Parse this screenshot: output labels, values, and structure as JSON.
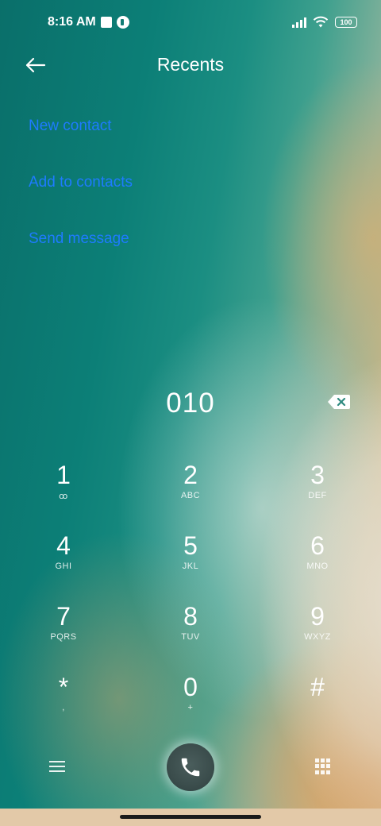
{
  "status_bar": {
    "time": "8:16 AM",
    "battery": "100"
  },
  "header": {
    "title": "Recents",
    "back_icon": "arrow-left-icon"
  },
  "actions": [
    {
      "label": "New contact"
    },
    {
      "label": "Add to contacts"
    },
    {
      "label": "Send message"
    }
  ],
  "dialer": {
    "number": "010",
    "keys": [
      {
        "digit": "1",
        "sub": "ꝏ"
      },
      {
        "digit": "2",
        "sub": "ABC"
      },
      {
        "digit": "3",
        "sub": "DEF"
      },
      {
        "digit": "4",
        "sub": "GHI"
      },
      {
        "digit": "5",
        "sub": "JKL"
      },
      {
        "digit": "6",
        "sub": "MNO"
      },
      {
        "digit": "7",
        "sub": "PQRS"
      },
      {
        "digit": "8",
        "sub": "TUV"
      },
      {
        "digit": "9",
        "sub": "WXYZ"
      },
      {
        "digit": "*",
        "sub": ","
      },
      {
        "digit": "0",
        "sub": "+"
      },
      {
        "digit": "#",
        "sub": ""
      }
    ]
  },
  "colors": {
    "action_link": "#1e7bff",
    "call_button": "#3b4d4c"
  }
}
